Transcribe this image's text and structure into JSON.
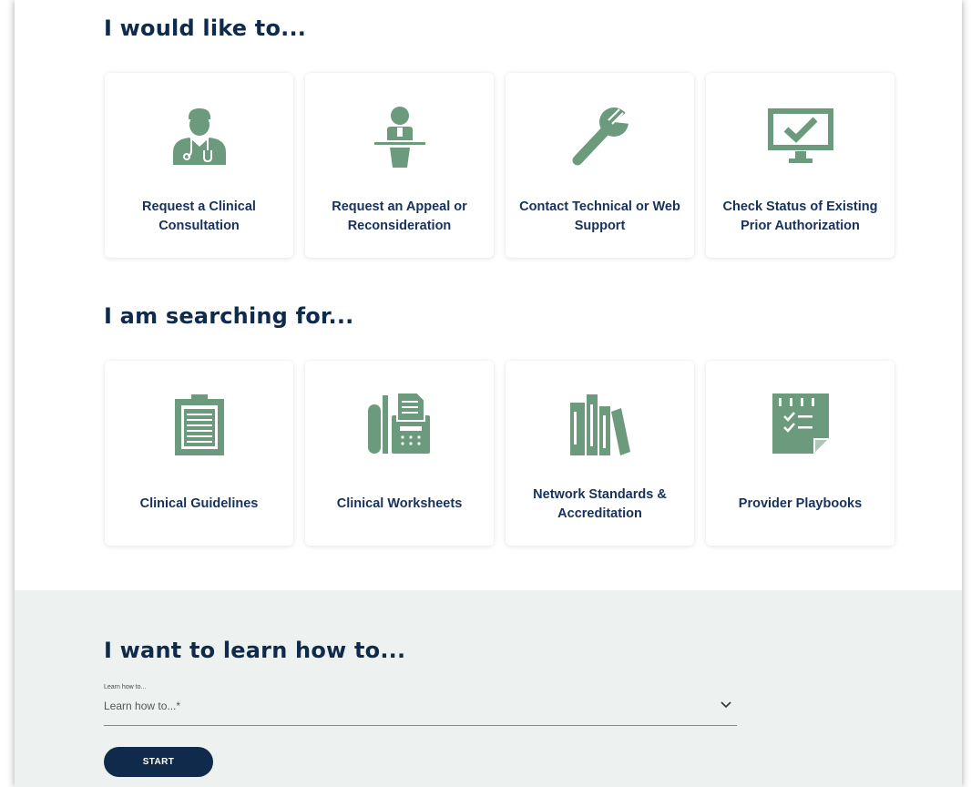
{
  "colors": {
    "icon_green": "#6b9a7d",
    "title_navy": "#0f2a4a",
    "label_navy": "#16325c",
    "learn_bg": "#edf2f0"
  },
  "sections": {
    "would_like": {
      "title": "I would like to...",
      "cards": [
        {
          "label": "Request a Clinical Consultation",
          "icon": "doctor-stethoscope-icon"
        },
        {
          "label": "Request an Appeal or Reconsideration",
          "icon": "speaker-podium-icon"
        },
        {
          "label": "Contact Technical or Web Support",
          "icon": "wrench-icon"
        },
        {
          "label": "Check Status of Existing Prior Authorization",
          "icon": "monitor-checkmark-icon"
        }
      ]
    },
    "searching": {
      "title": "I am searching for...",
      "cards": [
        {
          "label": "Clinical Guidelines",
          "icon": "clipboard-icon"
        },
        {
          "label": "Clinical Worksheets",
          "icon": "fax-machine-icon"
        },
        {
          "label": "Network Standards & Accreditation",
          "icon": "books-icon"
        },
        {
          "label": "Provider Playbooks",
          "icon": "checklist-document-icon"
        }
      ]
    },
    "learn": {
      "title": "I want to learn how to...",
      "field_label": "Learn how to...",
      "placeholder": "Learn how to...*",
      "button_label": "START"
    }
  }
}
